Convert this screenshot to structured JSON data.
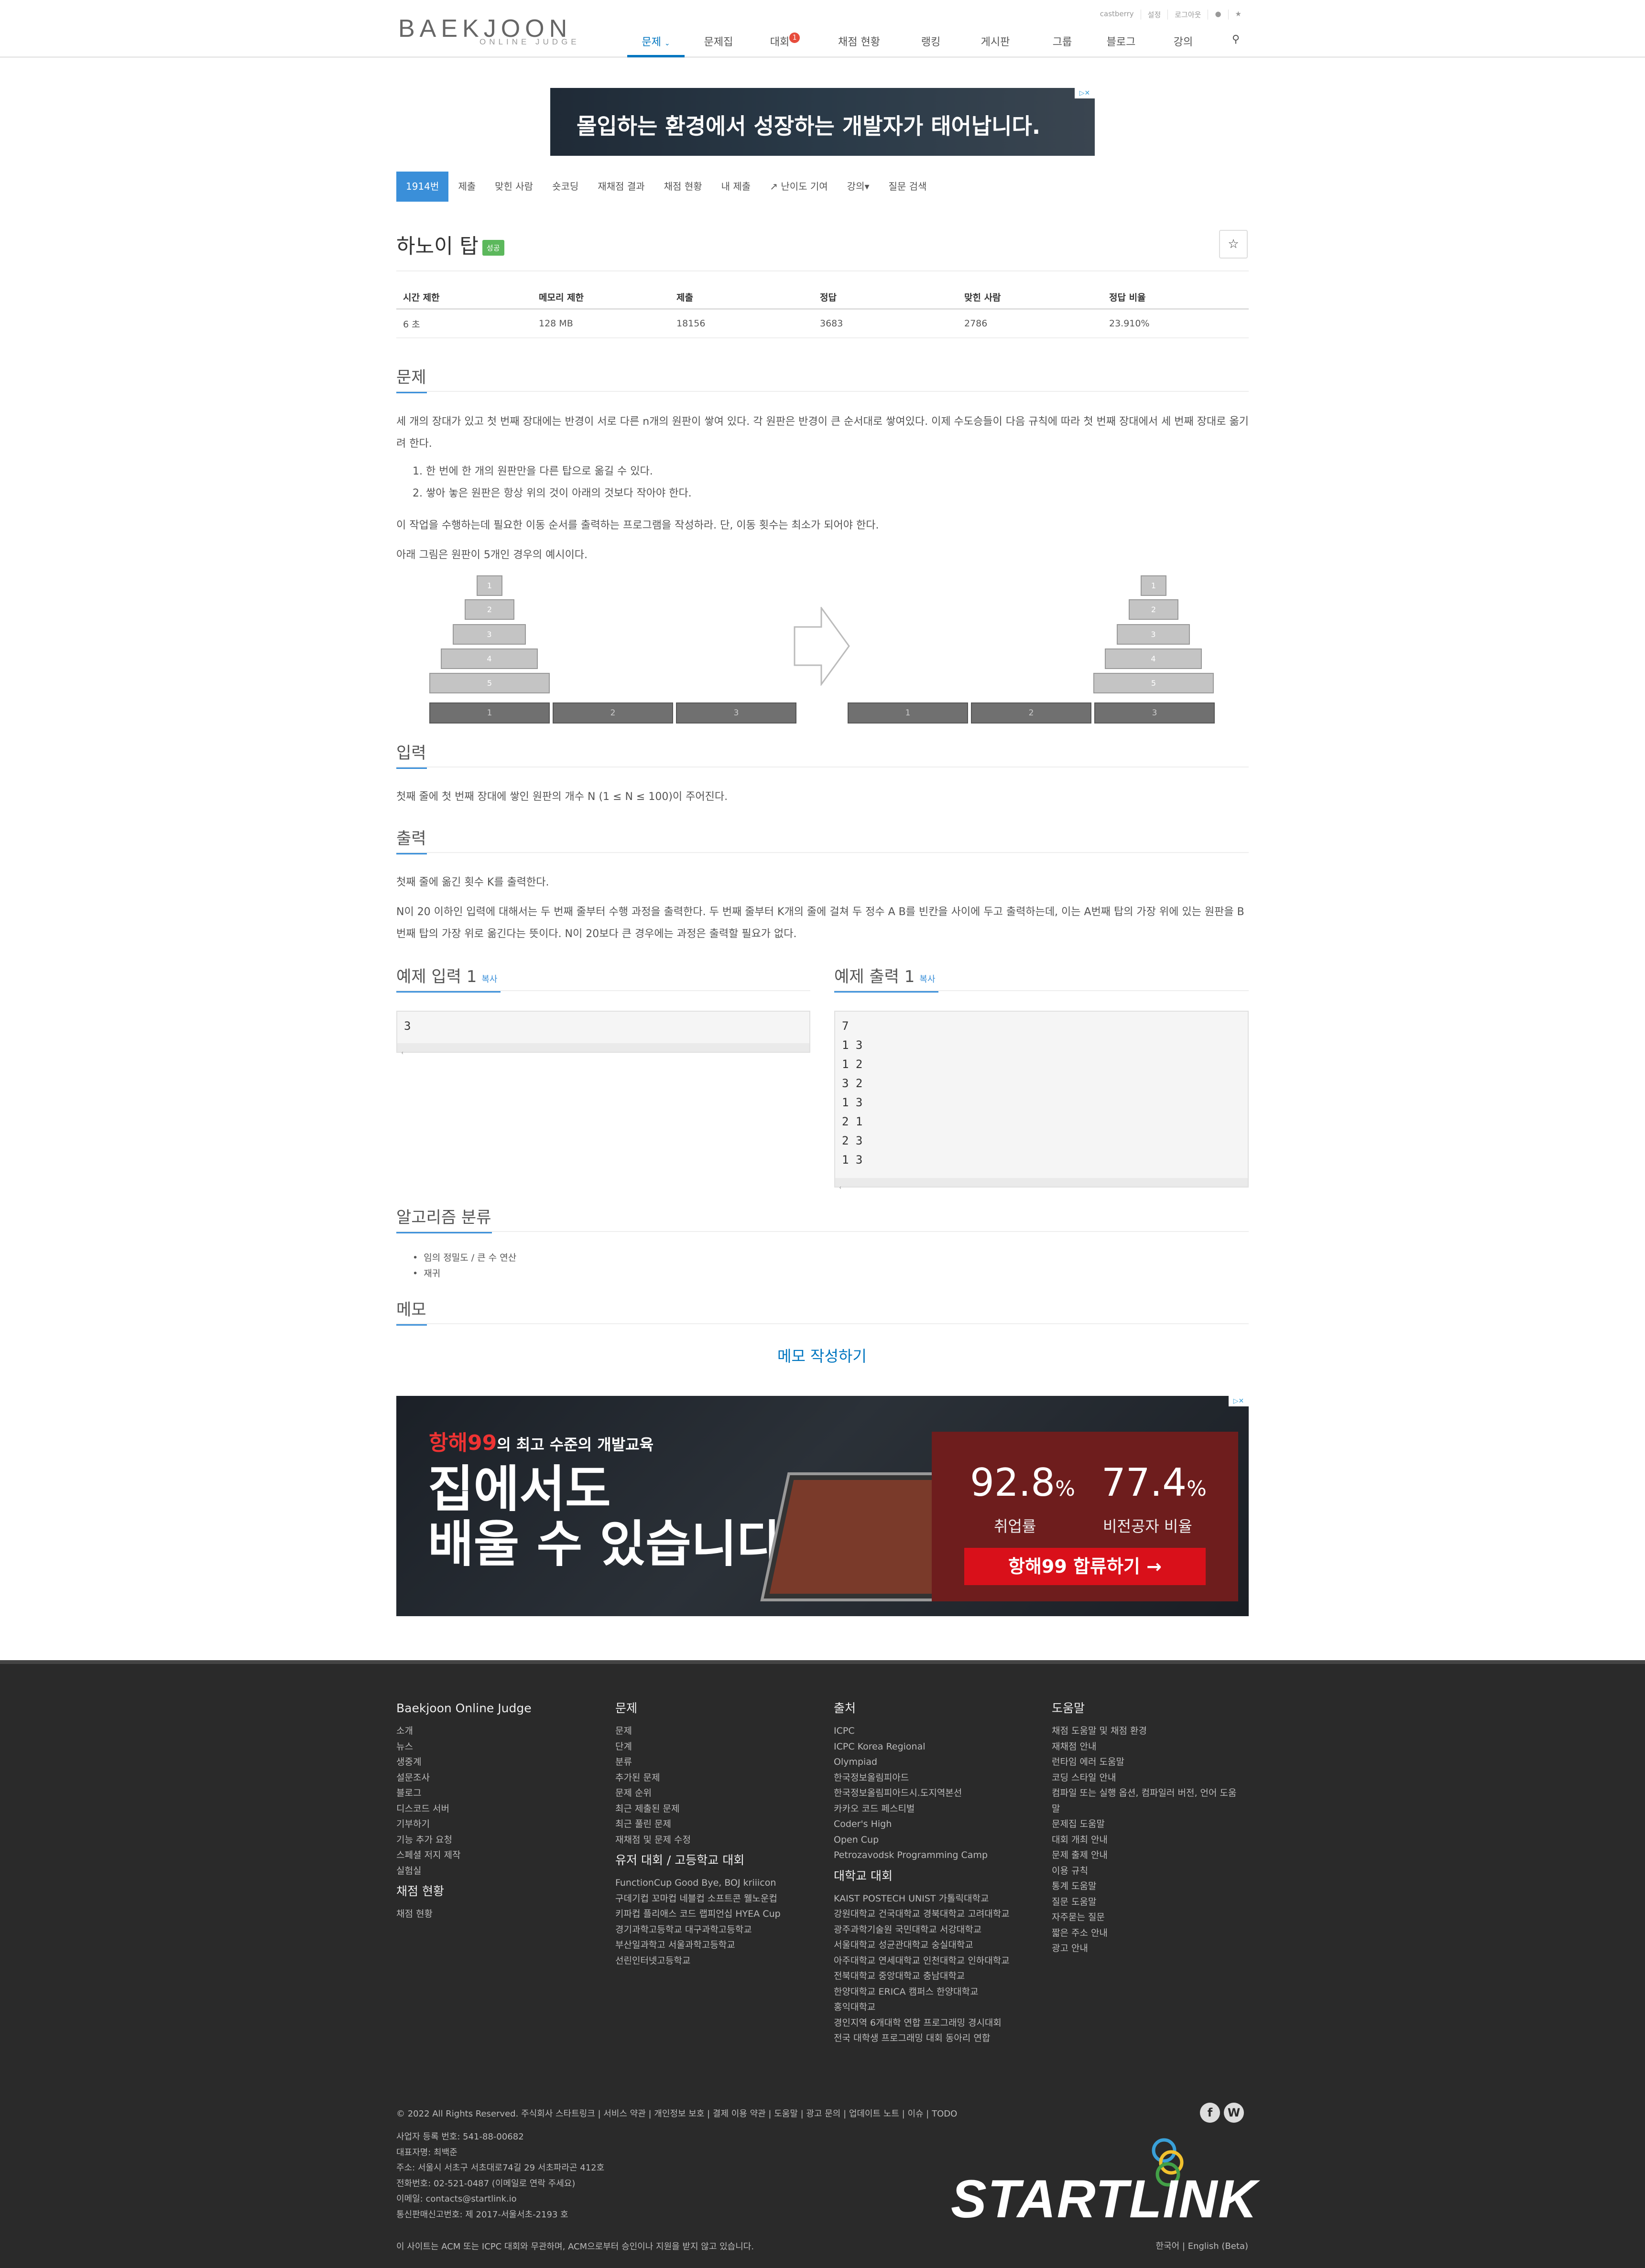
{
  "header": {
    "logo_main": "BAEKJOON",
    "logo_sub": "ONLINE JUDGE",
    "toplinks": [
      "castberry",
      "설정",
      "로그아웃"
    ],
    "nav": [
      {
        "label": "문제"
      },
      {
        "label": "문제집"
      },
      {
        "label": "대회"
      },
      {
        "label": "채점 현황"
      },
      {
        "label": "랭킹"
      },
      {
        "label": "게시판"
      },
      {
        "label": "그룹"
      },
      {
        "label": "블로그"
      },
      {
        "label": "강의"
      }
    ],
    "contest_badge": "1"
  },
  "ad_top": {
    "text": "몰입하는 환경에서 성장하는 개발자가 태어납니다."
  },
  "problem_menu": [
    "1914번",
    "제출",
    "맞힌 사람",
    "숏코딩",
    "재채점 결과",
    "채점 현황",
    "내 제출",
    "난이도 기여",
    "강의▾",
    "질문 검색"
  ],
  "problem": {
    "title": "하노이 탑",
    "status_badge": "성공",
    "table_headers": [
      "시간 제한",
      "메모리 제한",
      "제출",
      "정답",
      "맞힌 사람",
      "정답 비율"
    ],
    "table_values": [
      "6 초",
      "128 MB",
      "18156",
      "3683",
      "2786",
      "23.910%"
    ]
  },
  "sections": {
    "problem": "문제",
    "input": "입력",
    "output": "출력",
    "sample_input": "예제 입력 1",
    "sample_output": "예제 출력 1",
    "copy": "복사",
    "algorithm": "알고리즘 분류",
    "memo": "메모"
  },
  "statement": {
    "p1": "세 개의 장대가 있고 첫 번째 장대에는 반경이 서로 다른 n개의 원판이 쌓여 있다. 각 원판은 반경이 큰 순서대로 쌓여있다. 이제 수도승들이 다음 규칙에 따라 첫 번째 장대에서 세 번째 장대로 옮기려 한다.",
    "rule1": "1. 한 번에 한 개의 원판만을 다른 탑으로 옮길 수 있다.",
    "rule2": "2. 쌓아 놓은 원판은 항상 위의 것이 아래의 것보다 작아야 한다.",
    "p2": "이 작업을 수행하는데 필요한 이동 순서를 출력하는 프로그램을 작성하라. 단, 이동 횟수는 최소가 되어야 한다.",
    "p3": "아래 그림은 원판이 5개인 경우의 예시이다.",
    "disks": [
      "1",
      "2",
      "3",
      "4",
      "5"
    ],
    "pegs": [
      "1",
      "2",
      "3"
    ],
    "input": "첫째 줄에 첫 번째 장대에 쌓인 원판의 개수 N (1 ≤ N ≤ 100)이 주어진다.",
    "output1": "첫째 줄에 옮긴 횟수 K를 출력한다.",
    "output2": "N이 20 이하인 입력에 대해서는 두 번째 줄부터 수행 과정을 출력한다. 두 번째 줄부터 K개의 줄에 걸쳐 두 정수 A B를 빈칸을 사이에 두고 출력하는데, 이는 A번째 탑의 가장 위에 있는 원판을 B번째 탑의 가장 위로 옮긴다는 뜻이다. N이 20보다 큰 경우에는 과정은 출력할 필요가 없다."
  },
  "samples": {
    "input": "3",
    "output_lines": [
      "7",
      "1 3",
      "1 2",
      "3 2",
      "1 3",
      "2 1",
      "2 3",
      "1 3"
    ]
  },
  "algorithms": [
    "임의 정밀도 / 큰 수 연산",
    "재귀"
  ],
  "memo_link": "메모 작성하기",
  "ad_bottom": {
    "brand": "항해99",
    "headline_small": "의 최고 수준의 개발교육",
    "headline1": "집에서도",
    "headline2": "배울 수 있습니다",
    "stat1_value": "92.8",
    "stat1_label": "취업률",
    "stat2_value": "77.4",
    "stat2_label": "비전공자 비율",
    "percent": "%",
    "cta": "항해99 합류하기 →"
  },
  "footer": {
    "col1_title": "Baekjoon Online Judge",
    "col1": [
      "소개",
      "뉴스",
      "생중계",
      "설문조사",
      "블로그",
      "디스코드 서버",
      "기부하기",
      "기능 추가 요청",
      "스페셜 저지 제작",
      "실험실"
    ],
    "col1b_title": "채점 현황",
    "col1b": [
      "채점 현황"
    ],
    "col2_title": "문제",
    "col2": [
      "문제",
      "단계",
      "분류",
      "추가된 문제",
      "문제 순위",
      "최근 제출된 문제",
      "최근 풀린 문제",
      "재채점 및 문제 수정"
    ],
    "col2b_title": "유저 대회 / 고등학교 대회",
    "col2b": [
      "FunctionCup Good Bye, BOJ kriiicon",
      "구데기컵 꼬마컵 네블컵 소프트콘 웰노운컵",
      "키파컵 플리애스 코드 랩피언십 HYEA Cup",
      "경기과학고등학교 대구과학고등학교",
      "부산일과학고 서울과학고등학교",
      "선린인터넷고등학교"
    ],
    "col3_title": "출처",
    "col3": [
      "ICPC",
      "ICPC Korea Regional",
      "Olympiad",
      "한국정보올림피아드",
      "한국정보올림피아드시.도지역본선",
      "카카오 코드 페스티벌",
      "Coder's High",
      "Open Cup",
      "Petrozavodsk Programming Camp"
    ],
    "col3b_title": "대학교 대회",
    "col3b": [
      "KAIST POSTECH UNIST 가톨릭대학교",
      "강원대학교 건국대학교 경북대학교 고려대학교",
      "광주과학기술원 국민대학교 서강대학교",
      "서울대학교 성균관대학교 숭실대학교",
      "아주대학교 연세대학교 인천대학교 인하대학교",
      "전북대학교 중앙대학교 충남대학교",
      "한양대학교 ERICA 캠퍼스 한양대학교",
      "홍익대학교",
      "경인지역 6개대학 연합 프로그래밍 경시대회",
      "전국 대학생 프로그래밍 대회 동아리 연합"
    ],
    "col4_title": "도움말",
    "col4": [
      "채점 도움말 및 채점 환경",
      "재채점 안내",
      "런타임 에러 도움말",
      "코딩 스타일 안내",
      "컴파일 또는 실행 옵션, 컴파일러 버전, 언어 도움",
      "말",
      "문제집 도움말",
      "대회 개최 안내",
      "문제 출제 안내",
      "이용 규칙",
      "통계 도움말",
      "질문 도움말",
      "자주묻는 질문",
      "짧은 주소 안내",
      "광고 안내"
    ],
    "copyright": "© 2022 All Rights Reserved. 주식회사 스타트링크 | 서비스 약관 | 개인정보 보호 | 결제 이용 약관 | 도움말 | 광고 문의 | 업데이트 노트 | 이슈 | TODO",
    "company": [
      "사업자 등록 번호: 541-88-00682",
      "대표자명: 최백준",
      "주소: 서울시 서초구 서초대로74길 29 서초파라곤 412호",
      "전화번호: 02-521-0487 (이메일로 연락 주세요)",
      "이메일: contacts@startlink.io",
      "통신판매신고번호: 제 2017-서울서초-2193 호"
    ],
    "disclaimer": "이 사이트는 ACM 또는 ICPC 대회와 무관하며, ACM으로부터 승인이나 지원을 받지 않고 있습니다.",
    "lang": "한국어 | English (Beta)",
    "startlink": "STARTLINK"
  }
}
